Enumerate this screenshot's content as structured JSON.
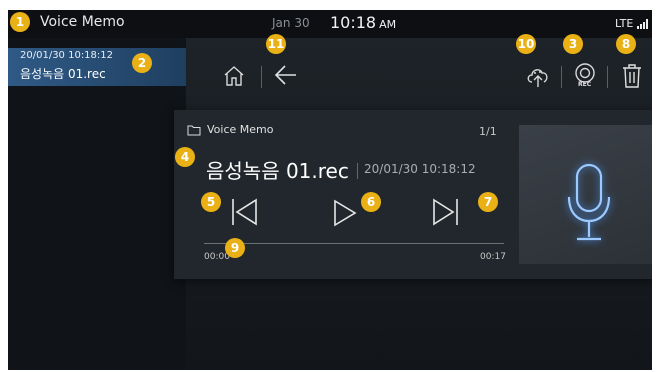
{
  "status_bar": {
    "app_title": "Voice Memo",
    "date": "Jan 30",
    "time": "10:18",
    "ampm": "AM",
    "network": "LTE",
    "signal_icon": "signal-bars-icon"
  },
  "sidebar": {
    "items": [
      {
        "date": "20/01/30 10:18:12",
        "name": "음성녹음 01.rec",
        "selected": true
      }
    ]
  },
  "toolbar": {
    "home_icon": "home-icon",
    "back_icon": "back-arrow-icon",
    "upload_icon": "cloud-upload-icon",
    "rec_icon": "record-icon",
    "rec_label": "REC",
    "delete_icon": "trash-icon"
  },
  "player": {
    "folder_icon": "folder-icon",
    "folder": "Voice Memo",
    "page": "1/1",
    "file_name": "음성녹음 01.rec",
    "file_date": "20/01/30 10:18:12",
    "time_start": "00:00",
    "time_end": "00:17",
    "progress": 0,
    "prev_icon": "skip-previous-icon",
    "play_icon": "play-icon",
    "next_icon": "skip-next-icon",
    "art_icon": "microphone-icon",
    "art_color": "#6fb0ff"
  },
  "callouts": [
    "1",
    "2",
    "3",
    "4",
    "5",
    "6",
    "7",
    "8",
    "9",
    "10",
    "11"
  ],
  "callout_color": "#e9b115"
}
